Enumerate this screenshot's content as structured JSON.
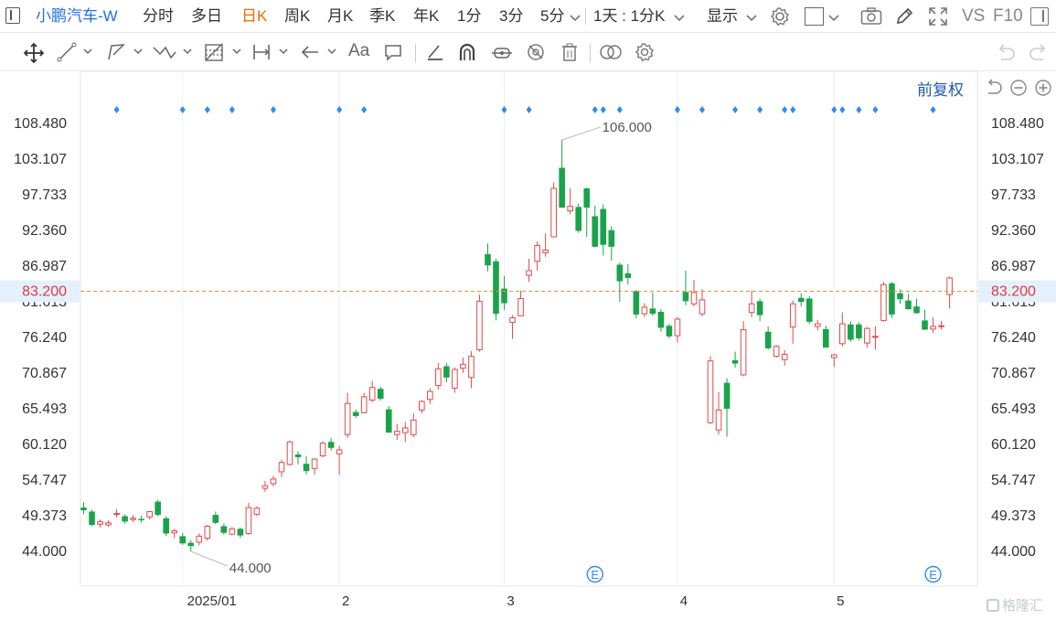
{
  "header": {
    "stock_name": "小鹏汽车-W",
    "periods": [
      "分时",
      "多日",
      "日K",
      "周K",
      "月K",
      "季K",
      "年K",
      "1分",
      "3分",
      "5分"
    ],
    "active_period": "日K",
    "multi_select": "1天 : 1分K",
    "display_label": "显示",
    "vs_label": "VS",
    "f10_label": "F10"
  },
  "toolbar": {
    "icons": [
      "move-icon",
      "line-icon",
      "polyline-icon",
      "wave-icon",
      "fib-icon",
      "measure-icon",
      "arrow-icon",
      "text-icon",
      "comment-icon",
      "pen-icon",
      "magnet-icon",
      "lock-icon",
      "hide-icon",
      "trash-icon",
      "link-icon",
      "settings-icon",
      "undo-icon",
      "redo-icon"
    ],
    "text_tool_label": "Aa"
  },
  "adjust_label": "前复权",
  "colors": {
    "up": "#e14a4a",
    "down": "#1ba34a",
    "current_line": "#e8903a",
    "current_bg": "#e5f0fd",
    "current_text": "#e03a3a",
    "marker": "#2f8cf0",
    "event": "#2f8cf0",
    "axis_text": "#333333",
    "grid": "#eef0f3"
  },
  "chart_data": {
    "type": "candlestick",
    "y_ticks": [
      "108.480",
      "103.107",
      "97.733",
      "92.360",
      "86.987",
      "81.613",
      "76.240",
      "70.867",
      "65.493",
      "60.120",
      "54.747",
      "49.373",
      "44.000"
    ],
    "ylim": [
      44.0,
      108.48
    ],
    "x_labels": [
      "2025/01",
      "2",
      "3",
      "4",
      "5"
    ],
    "x_label_index": [
      12,
      31,
      51,
      72,
      91
    ],
    "current_price": "83.200",
    "max_label": "106.000",
    "min_label": "44.000",
    "max_index": 58,
    "min_index": 13,
    "event_label": "E",
    "event_index": [
      62,
      103
    ],
    "marker_index": [
      4,
      12,
      15,
      18,
      23,
      31,
      34,
      51,
      54,
      62,
      63,
      65,
      72,
      75,
      79,
      82,
      85,
      86,
      91,
      92,
      94,
      96,
      103
    ],
    "ohlc": [
      [
        50.6,
        51.4,
        49.6,
        50.2
      ],
      [
        50.0,
        50.3,
        47.8,
        48.0
      ],
      [
        48.1,
        48.8,
        47.6,
        48.5
      ],
      [
        48.0,
        48.7,
        47.7,
        48.3
      ],
      [
        49.6,
        50.4,
        49.1,
        49.7
      ],
      [
        49.3,
        49.6,
        48.2,
        48.5
      ],
      [
        48.8,
        49.5,
        48.4,
        49.0
      ],
      [
        48.9,
        49.4,
        48.3,
        48.7
      ],
      [
        49.2,
        50.1,
        48.8,
        50.0
      ],
      [
        51.5,
        51.8,
        49.3,
        49.5
      ],
      [
        49.0,
        49.3,
        46.3,
        46.7
      ],
      [
        46.8,
        47.4,
        46.0,
        47.1
      ],
      [
        46.3,
        46.8,
        45.0,
        45.2
      ],
      [
        45.3,
        45.7,
        44.0,
        44.8
      ],
      [
        45.4,
        46.7,
        44.9,
        46.3
      ],
      [
        46.0,
        48.0,
        45.6,
        47.8
      ],
      [
        49.5,
        50.0,
        48.1,
        48.3
      ],
      [
        47.8,
        48.2,
        46.5,
        46.8
      ],
      [
        46.6,
        47.7,
        46.4,
        47.4
      ],
      [
        47.4,
        47.6,
        46.0,
        46.4
      ],
      [
        46.7,
        51.3,
        46.5,
        50.6
      ],
      [
        49.6,
        50.8,
        49.3,
        50.5
      ],
      [
        53.5,
        54.6,
        53.0,
        53.9
      ],
      [
        54.2,
        55.4,
        53.8,
        54.9
      ],
      [
        56.0,
        57.8,
        55.2,
        57.4
      ],
      [
        57.1,
        60.7,
        56.9,
        60.5
      ],
      [
        58.6,
        59.1,
        57.1,
        58.2
      ],
      [
        57.2,
        58.4,
        55.6,
        56.1
      ],
      [
        56.5,
        58.1,
        55.6,
        57.9
      ],
      [
        58.4,
        60.6,
        58.2,
        60.3
      ],
      [
        60.5,
        61.1,
        59.2,
        59.6
      ],
      [
        58.7,
        59.9,
        55.5,
        59.3
      ],
      [
        61.6,
        67.9,
        61.1,
        66.3
      ],
      [
        65.0,
        65.4,
        64.1,
        64.4
      ],
      [
        64.9,
        67.9,
        64.8,
        67.3
      ],
      [
        66.8,
        69.7,
        66.5,
        68.7
      ],
      [
        68.5,
        68.8,
        66.7,
        67.0
      ],
      [
        65.4,
        65.9,
        61.9,
        61.9
      ],
      [
        61.6,
        63.2,
        60.8,
        62.1
      ],
      [
        61.9,
        63.5,
        60.5,
        62.6
      ],
      [
        61.6,
        64.8,
        61.2,
        63.8
      ],
      [
        65.3,
        66.8,
        64.8,
        66.6
      ],
      [
        66.9,
        68.6,
        66.2,
        68.1
      ],
      [
        69.0,
        72.4,
        68.4,
        71.5
      ],
      [
        71.9,
        72.4,
        69.5,
        70.2
      ],
      [
        68.6,
        71.7,
        67.9,
        71.4
      ],
      [
        71.6,
        73.2,
        70.9,
        72.2
      ],
      [
        70.2,
        74.2,
        68.6,
        73.4
      ],
      [
        74.4,
        82.7,
        74.1,
        81.7
      ],
      [
        88.8,
        90.4,
        86.2,
        87.1
      ],
      [
        87.7,
        88.1,
        78.8,
        79.8
      ],
      [
        83.6,
        85.5,
        80.4,
        81.4
      ],
      [
        78.5,
        79.6,
        76.0,
        79.2
      ],
      [
        79.5,
        83.3,
        79.4,
        82.1
      ],
      [
        85.6,
        88.1,
        84.6,
        86.3
      ],
      [
        87.7,
        90.7,
        86.3,
        90.1
      ],
      [
        89.0,
        91.9,
        88.4,
        89.4
      ],
      [
        91.4,
        99.6,
        91.3,
        98.7
      ],
      [
        101.8,
        106.0,
        95.8,
        95.8
      ],
      [
        95.3,
        98.7,
        94.8,
        96.0
      ],
      [
        95.9,
        96.4,
        92.0,
        92.3
      ],
      [
        98.7,
        98.8,
        91.4,
        95.8
      ],
      [
        94.5,
        96.1,
        89.8,
        89.9
      ],
      [
        95.6,
        96.3,
        88.6,
        90.2
      ],
      [
        92.4,
        93.0,
        87.8,
        89.9
      ],
      [
        87.2,
        87.5,
        81.6,
        84.7
      ],
      [
        85.9,
        87.3,
        84.2,
        85.2
      ],
      [
        83.2,
        83.4,
        79.1,
        79.7
      ],
      [
        79.8,
        81.4,
        79.3,
        80.8
      ],
      [
        80.6,
        83.0,
        79.5,
        79.8
      ],
      [
        80.1,
        80.5,
        77.1,
        77.7
      ],
      [
        78.0,
        78.3,
        76.1,
        76.4
      ],
      [
        76.5,
        79.3,
        75.5,
        79.0
      ],
      [
        83.1,
        86.3,
        81.1,
        81.7
      ],
      [
        81.3,
        84.9,
        80.9,
        83.0
      ],
      [
        79.8,
        83.5,
        79.4,
        81.9
      ],
      [
        63.4,
        73.4,
        63.2,
        72.7
      ],
      [
        62.3,
        68.0,
        61.6,
        65.3
      ],
      [
        69.4,
        70.1,
        61.3,
        65.5
      ],
      [
        72.8,
        74.1,
        71.7,
        72.3
      ],
      [
        70.6,
        78.7,
        70.4,
        77.4
      ],
      [
        80.0,
        83.3,
        79.3,
        81.3
      ],
      [
        81.7,
        82.1,
        78.7,
        79.6
      ],
      [
        77.1,
        77.9,
        74.4,
        74.6
      ],
      [
        73.4,
        75.1,
        73.2,
        74.9
      ],
      [
        72.9,
        74.3,
        72.0,
        73.7
      ],
      [
        77.8,
        81.8,
        75.3,
        81.3
      ],
      [
        82.2,
        82.9,
        80.9,
        81.6
      ],
      [
        82.1,
        82.5,
        78.3,
        78.6
      ],
      [
        77.9,
        78.9,
        77.3,
        78.3
      ],
      [
        77.5,
        78.0,
        74.7,
        74.7
      ],
      [
        73.2,
        73.8,
        71.8,
        73.6
      ],
      [
        75.3,
        80.0,
        74.9,
        78.3
      ],
      [
        78.2,
        78.7,
        75.6,
        75.9
      ],
      [
        78.2,
        78.5,
        75.8,
        76.1
      ],
      [
        75.4,
        77.8,
        74.7,
        77.6
      ],
      [
        76.4,
        77.9,
        74.4,
        76.4
      ],
      [
        78.8,
        84.6,
        78.6,
        84.2
      ],
      [
        84.4,
        84.6,
        79.2,
        79.7
      ],
      [
        82.9,
        83.5,
        81.3,
        82.0
      ],
      [
        81.8,
        82.8,
        80.4,
        80.5
      ],
      [
        80.9,
        82.1,
        79.8,
        79.9
      ],
      [
        78.8,
        80.4,
        77.4,
        77.4
      ],
      [
        77.5,
        79.3,
        76.9,
        77.9
      ],
      [
        77.9,
        78.7,
        77.4,
        78.0
      ],
      [
        82.7,
        85.4,
        80.6,
        85.2
      ]
    ]
  },
  "watermark": "格隆汇"
}
